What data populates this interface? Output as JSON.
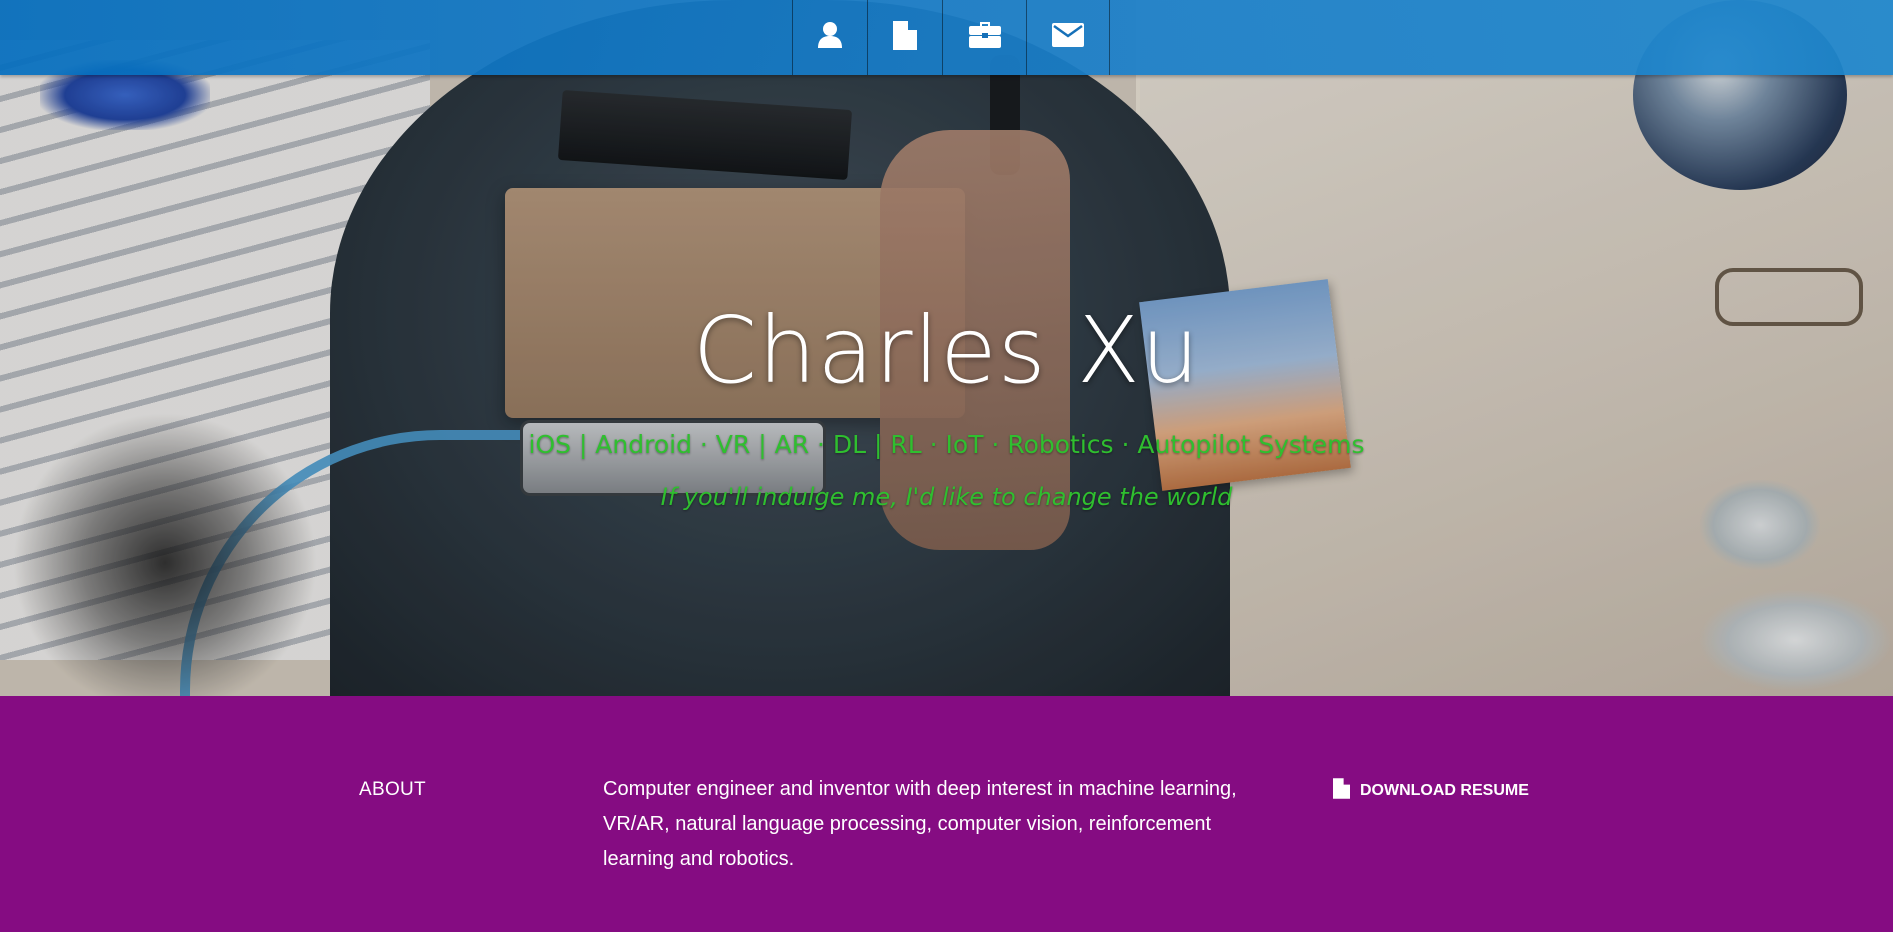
{
  "nav": {
    "items": [
      {
        "icon": "user-icon"
      },
      {
        "icon": "document-icon"
      },
      {
        "icon": "briefcase-icon"
      },
      {
        "icon": "envelope-icon"
      }
    ]
  },
  "hero": {
    "title": "Charles Xu",
    "subtitle": "iOS | Android · VR | AR · DL | RL · IoT · Robotics · Autopilot Systems",
    "tagline": "If you'll indulge me, I'd like to change the world"
  },
  "about": {
    "heading": "ABOUT",
    "text": "Computer engineer and inventor with deep interest in machine learning, VR/AR, natural language processing, computer vision, reinforcement learning and robotics.",
    "download_label": "DOWNLOAD RESUME",
    "download_icon": "document-icon"
  },
  "colors": {
    "navbar": "#0a6fbf",
    "hero_text": "#ffffff",
    "subtitle_text": "#2fbf2f",
    "about_background": "#850c82"
  }
}
